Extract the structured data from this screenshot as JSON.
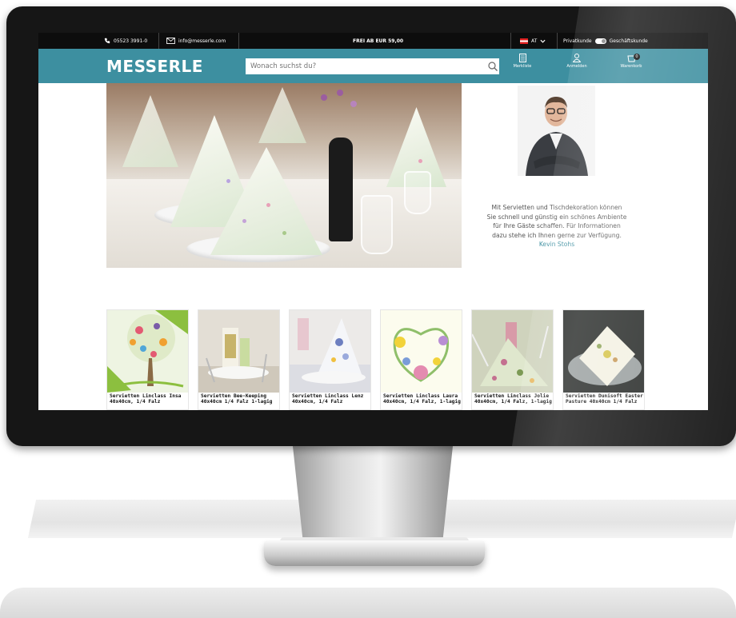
{
  "topbar": {
    "phone": "05523 3991-0",
    "email": "info@messerle.com",
    "shipping": "FREI AB EUR 59,00",
    "country": "AT",
    "private_label": "Privatkunde",
    "business_label": "Geschäftskunde"
  },
  "header": {
    "logo": "MESSERLE",
    "search_placeholder": "Wonach suchst du?",
    "nav": [
      {
        "label": "Merkliste",
        "icon": "clipboard-icon"
      },
      {
        "label": "Anmelden",
        "icon": "user-icon"
      },
      {
        "label": "Warenkorb",
        "icon": "cart-icon",
        "badge": "0"
      }
    ],
    "accent_color": "#3d8fa0"
  },
  "quote": {
    "text": "Mit Servietten und Tischdekoration können Sie schnell und günstig ein schönes Ambiente für Ihre Gäste schaffen. Für Informationen dazu stehe ich Ihnen gerne zur Verfügung.",
    "author": "Kevin Stohs"
  },
  "products": [
    {
      "title": "Servietten Linclass Insa 40x40cm, 1/4 Falz"
    },
    {
      "title": "Servietten Bee-Keeping 40x40cm 1/4 Falz 1-lagig"
    },
    {
      "title": "Servietten Linclass Lenz 40x40cm, 1/4 Falz"
    },
    {
      "title": "Servietten Linclass Laura 40x40cm, 1/4 Falz, 1-lagig"
    },
    {
      "title": "Servietten Linclass Jolie 40x40cm, 1/4 Falz, 1-lagig"
    },
    {
      "title": "Servietten Dunisoft Easter Pasture 40x40cm 1/4 Falz"
    }
  ]
}
